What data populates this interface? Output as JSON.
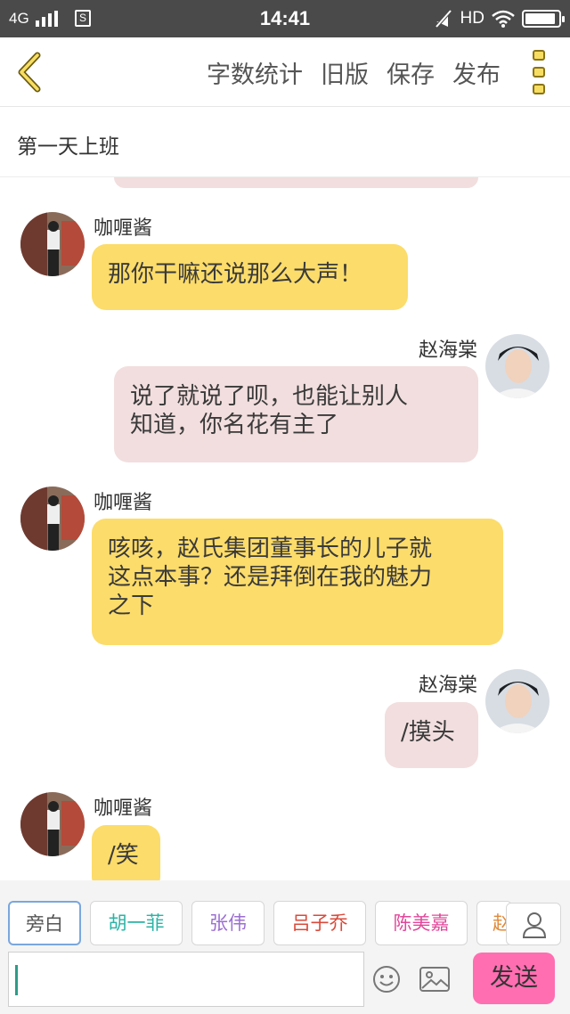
{
  "status_bar": {
    "network": "4G",
    "time": "14:41",
    "hd": "HD",
    "sim_icon": "S",
    "battery_level": 0.92,
    "icons": [
      "signal-bars-icon",
      "sim-icon",
      "mute-icon",
      "wifi-icon",
      "battery-icon"
    ]
  },
  "toolbar": {
    "back_icon": "chevron-left-icon",
    "items": [
      "字数统计",
      "旧版",
      "保存",
      "发布"
    ],
    "more_icon": "more-vertical-icon"
  },
  "chapter_title": "第一天上班",
  "messages": [
    {
      "side": "left",
      "name": "咖喱酱",
      "text": "那你干嘛还说那么大声！"
    },
    {
      "side": "right",
      "name": "赵海棠",
      "lines": [
        "说了就说了呗，也能让别人",
        "知道，你名花有主了"
      ]
    },
    {
      "side": "left",
      "name": "咖喱酱",
      "lines": [
        "咳咳，赵氏集团董事长的儿子就",
        "这点本事？还是拜倒在我的魅力",
        "之下"
      ]
    },
    {
      "side": "right",
      "name": "赵海棠",
      "text": "/摸头"
    },
    {
      "side": "left",
      "name": "咖喱酱",
      "text": "/笑"
    }
  ],
  "roles": [
    {
      "label": "旁白",
      "color": "#555555"
    },
    {
      "label": "胡一菲",
      "color": "#2bb3a6"
    },
    {
      "label": "张伟",
      "color": "#9b6fd1"
    },
    {
      "label": "吕子乔",
      "color": "#d94a3a"
    },
    {
      "label": "陈美嘉",
      "color": "#e0489a"
    },
    {
      "label": "赵",
      "color": "#e08a3a"
    }
  ],
  "role_icon": "person-icon",
  "input": {
    "value": ""
  },
  "emoji_icon": "smiley-icon",
  "image_icon": "image-icon",
  "send_label": "发送"
}
